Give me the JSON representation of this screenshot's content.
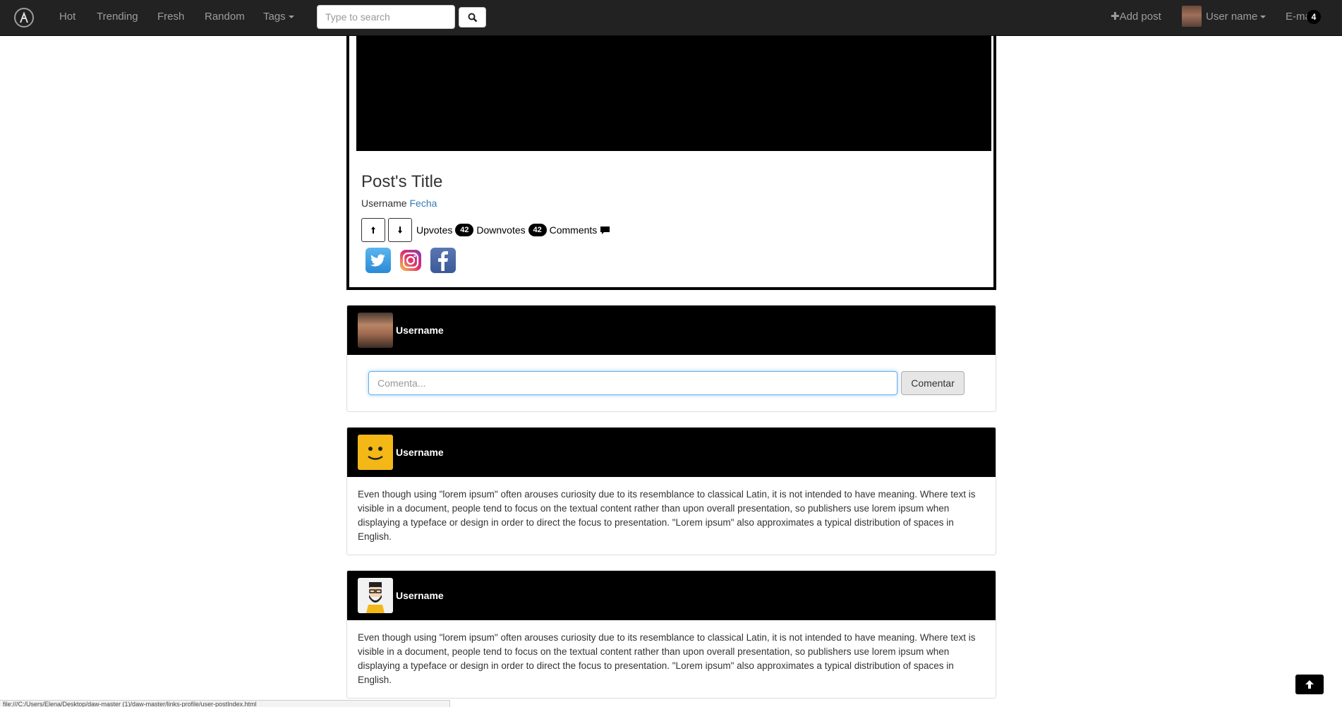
{
  "navbar": {
    "brand_icon": "logo-icon",
    "links": [
      "Hot",
      "Trending",
      "Fresh",
      "Random"
    ],
    "tags_label": "Tags",
    "search": {
      "placeholder": "Type to search",
      "button_icon": "search-icon"
    },
    "add_post_label": "Add post",
    "username_label": "User name",
    "email_label": "E-mail",
    "email_count": "4"
  },
  "post": {
    "title": "Post's Title",
    "author": "Username",
    "date_link": "Fecha",
    "upvotes_label": "Upvotes",
    "upvotes_count": "42",
    "downvotes_label": "Downvotes",
    "downvotes_count": "42",
    "comments_label": "Comments",
    "social": [
      "twitter-icon",
      "instagram-icon",
      "facebook-icon"
    ]
  },
  "compose": {
    "username": "Username",
    "placeholder": "Comenta...",
    "button_label": "Comentar"
  },
  "comments": [
    {
      "username": "Username",
      "avatar": "smiley-avatar",
      "text": "Even though using \"lorem ipsum\" often arouses curiosity due to its resemblance to classical Latin, it is not intended to have meaning. Where text is visible in a document, people tend to focus on the textual content rather than upon overall presentation, so publishers use lorem ipsum when displaying a typeface or design in order to direct the focus to presentation. \"Lorem ipsum\" also approximates a typical distribution of spaces in English."
    },
    {
      "username": "Username",
      "avatar": "bearded-avatar",
      "text": "Even though using \"lorem ipsum\" often arouses curiosity due to its resemblance to classical Latin, it is not intended to have meaning. Where text is visible in a document, people tend to focus on the textual content rather than upon overall presentation, so publishers use lorem ipsum when displaying a typeface or design in order to direct the focus to presentation. \"Lorem ipsum\" also approximates a typical distribution of spaces in English."
    }
  ],
  "status_bar": "file:///C:/Users/Elena/Desktop/daw-master (1)/daw-master/links-profile/user-postIndex.html",
  "colors": {
    "navbar": "#222222",
    "nav_text": "#9d9d9d",
    "card_header": "#000000",
    "link": "#337ab7"
  }
}
